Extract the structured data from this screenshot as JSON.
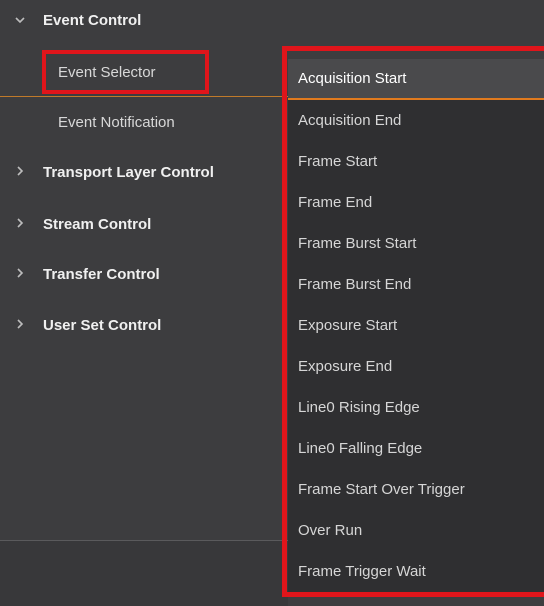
{
  "tree": {
    "event_control": {
      "label": "Event Control",
      "expanded": true
    },
    "children": [
      {
        "label": "Event Selector"
      },
      {
        "label": "Event Notification"
      }
    ],
    "categories": [
      {
        "label": "Transport Layer Control"
      },
      {
        "label": "Stream Control"
      },
      {
        "label": "Transfer Control"
      },
      {
        "label": "User Set Control"
      }
    ],
    "collapsed_arrow": ">",
    "expanded_arrow": "⌵"
  },
  "dropdown": {
    "selected": "Acquisition Start",
    "options": [
      "Acquisition Start",
      "Acquisition End",
      "Frame Start",
      "Frame End",
      "Frame Burst Start",
      "Frame Burst End",
      "Exposure Start",
      "Exposure End",
      "Line0 Rising Edge",
      "Line0 Falling Edge",
      "Frame Start Over Trigger",
      "Over Run",
      "Frame Trigger Wait"
    ]
  },
  "colors": {
    "background": "#3d3d3f",
    "highlight_border": "#e0151b",
    "accent_orange": "#e07a1e"
  }
}
